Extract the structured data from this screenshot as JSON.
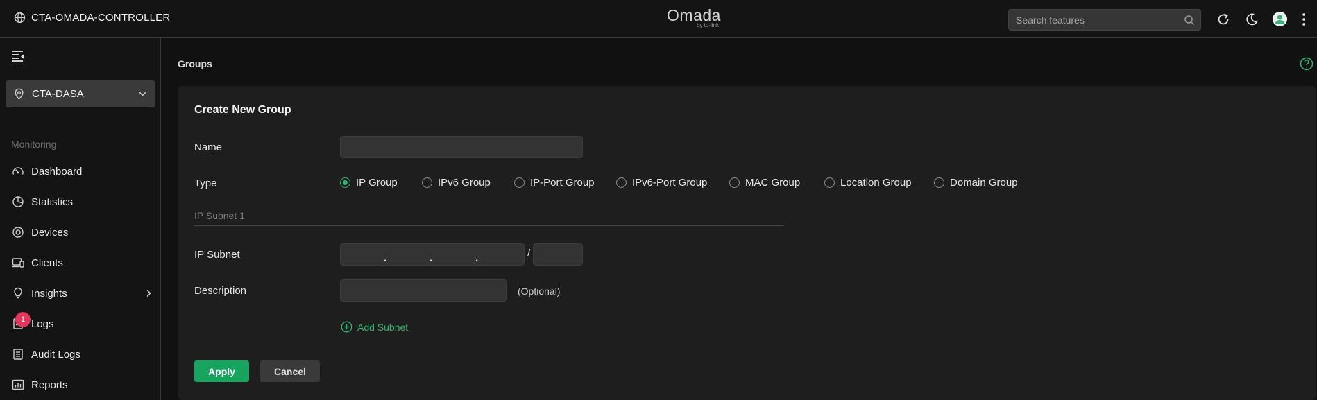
{
  "header": {
    "controller_name": "CTA-OMADA-CONTROLLER",
    "brand": "Omada",
    "brand_sub": "by tp-link",
    "search_placeholder": "Search features"
  },
  "sidebar": {
    "site": "CTA-DASA",
    "section": "Monitoring",
    "items": [
      {
        "label": "Dashboard",
        "icon": "dashboard-icon"
      },
      {
        "label": "Statistics",
        "icon": "statistics-icon"
      },
      {
        "label": "Devices",
        "icon": "devices-icon"
      },
      {
        "label": "Clients",
        "icon": "clients-icon"
      },
      {
        "label": "Insights",
        "icon": "insights-icon",
        "has_submenu": true
      },
      {
        "label": "Logs",
        "icon": "logs-icon",
        "badge": "1"
      },
      {
        "label": "Audit Logs",
        "icon": "audit-logs-icon"
      },
      {
        "label": "Reports",
        "icon": "reports-icon"
      }
    ]
  },
  "page": {
    "title": "Groups"
  },
  "form": {
    "title": "Create New Group",
    "name_label": "Name",
    "name_value": "",
    "type_label": "Type",
    "types": [
      {
        "label": "IP Group",
        "selected": true
      },
      {
        "label": "IPv6 Group",
        "selected": false
      },
      {
        "label": "IP-Port Group",
        "selected": false
      },
      {
        "label": "IPv6-Port Group",
        "selected": false
      },
      {
        "label": "MAC Group",
        "selected": false
      },
      {
        "label": "Location Group",
        "selected": false
      },
      {
        "label": "Domain Group",
        "selected": false
      }
    ],
    "subnet_heading": "IP Subnet 1",
    "ip_subnet_label": "IP Subnet",
    "ip_separator": ".",
    "mask_separator": "/",
    "description_label": "Description",
    "description_hint": "(Optional)",
    "add_subnet": "Add Subnet",
    "apply": "Apply",
    "cancel": "Cancel"
  },
  "colors": {
    "accent": "#2bb673",
    "apply_button": "#17a45f",
    "badge": "#e6355a",
    "background": "#111111",
    "card": "#1e1e1e"
  }
}
